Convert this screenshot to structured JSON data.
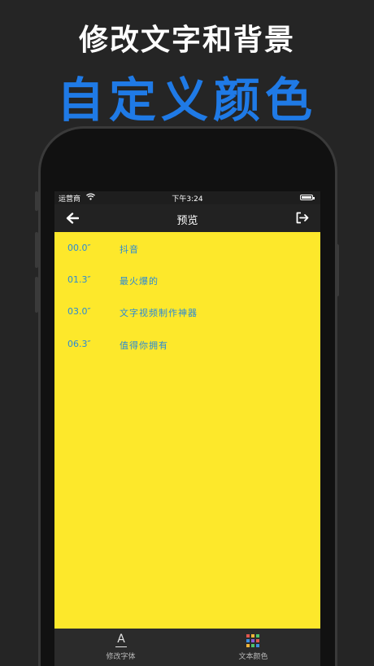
{
  "promo": {
    "headline": "修改文字和背景",
    "subheadline": "自定义颜色"
  },
  "statusbar": {
    "carrier": "运营商",
    "time": "下午3:24"
  },
  "navbar": {
    "title": "预览",
    "back_icon": "arrow-left-icon",
    "export_icon": "export-icon"
  },
  "preview": {
    "background": "#fde82b",
    "text_color": "#2a8ad6",
    "lines": [
      {
        "time": "00.0″",
        "text": "抖音"
      },
      {
        "time": "01.3″",
        "text": "最火爆的"
      },
      {
        "time": "03.0″",
        "text": "文字视频制作神器"
      },
      {
        "time": "06.3″",
        "text": "值得你拥有"
      }
    ]
  },
  "tabbar": {
    "tabs": [
      {
        "label": "修改字体",
        "icon": "font-icon"
      },
      {
        "label": "文本颜色",
        "icon": "color-grid-icon"
      }
    ]
  },
  "colors": {
    "accent_blue": "#1f7ae6",
    "swatches": [
      "#e0564e",
      "#f1b53a",
      "#4fc46a",
      "#3d8fe0",
      "#8c5ad8",
      "#e0564e",
      "#f1b53a",
      "#4fc46a",
      "#3d8fe0"
    ]
  }
}
